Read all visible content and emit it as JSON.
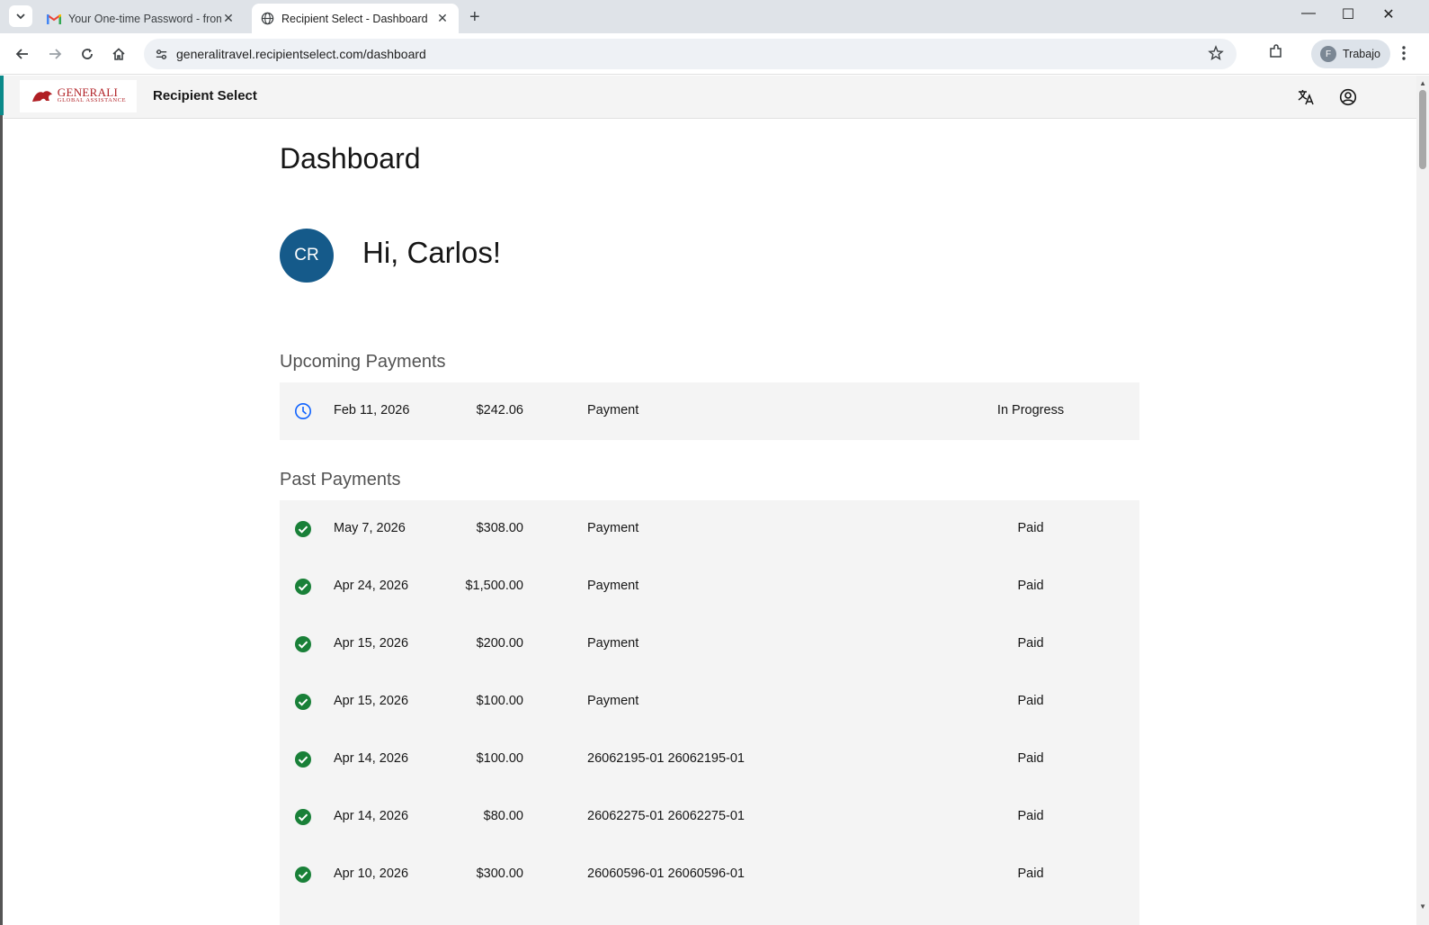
{
  "browser": {
    "tabs": [
      {
        "title": "Your One-time Password - from",
        "icon": "gmail-icon",
        "active": false
      },
      {
        "title": "Recipient Select - Dashboard",
        "icon": "globe-icon",
        "active": true
      }
    ],
    "url": "generalitravel.recipientselect.com/dashboard",
    "profile_initial": "F",
    "profile_label": "Trabajo"
  },
  "header": {
    "logo_line1": "GENERALI",
    "logo_line2": "GLOBAL ASSISTANCE",
    "app_name": "Recipient Select"
  },
  "page": {
    "title": "Dashboard",
    "avatar_initials": "CR",
    "greeting": "Hi, Carlos!"
  },
  "upcoming": {
    "title": "Upcoming Payments",
    "rows": [
      {
        "date": "Feb 11, 2026",
        "amount": "$242.06",
        "description": "Payment",
        "status": "In Progress",
        "icon": "clock-icon"
      }
    ]
  },
  "past": {
    "title": "Past Payments",
    "rows": [
      {
        "date": "May 7, 2026",
        "amount": "$308.00",
        "description": "Payment",
        "status": "Paid",
        "icon": "check-circle-icon"
      },
      {
        "date": "Apr 24, 2026",
        "amount": "$1,500.00",
        "description": "Payment",
        "status": "Paid",
        "icon": "check-circle-icon"
      },
      {
        "date": "Apr 15, 2026",
        "amount": "$200.00",
        "description": "Payment",
        "status": "Paid",
        "icon": "check-circle-icon"
      },
      {
        "date": "Apr 15, 2026",
        "amount": "$100.00",
        "description": "Payment",
        "status": "Paid",
        "icon": "check-circle-icon"
      },
      {
        "date": "Apr 14, 2026",
        "amount": "$100.00",
        "description": "26062195-01 26062195-01",
        "status": "Paid",
        "icon": "check-circle-icon"
      },
      {
        "date": "Apr 14, 2026",
        "amount": "$80.00",
        "description": "26062275-01 26062275-01",
        "status": "Paid",
        "icon": "check-circle-icon"
      },
      {
        "date": "Apr 10, 2026",
        "amount": "$300.00",
        "description": "26060596-01 26060596-01",
        "status": "Paid",
        "icon": "check-circle-icon"
      }
    ]
  },
  "colors": {
    "accent": "#155a8a",
    "paid_green": "#198038",
    "clock_blue": "#0f62fe",
    "brand_red": "#b01e23"
  }
}
